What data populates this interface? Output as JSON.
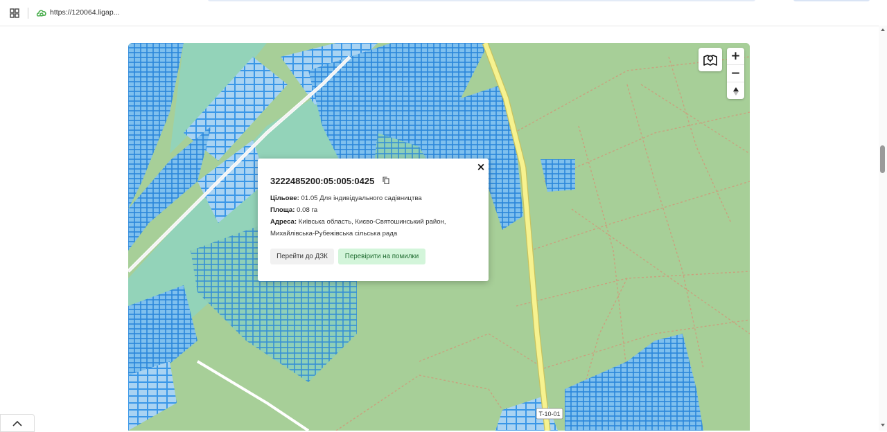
{
  "browser": {
    "url": "https://120064.ligap..."
  },
  "map": {
    "road_label": "T-10-01",
    "zoom_in": "+",
    "zoom_out": "−",
    "reset_north": "▲",
    "layers_icon": "map-layers-icon",
    "colors": {
      "forest": "#a7cf98",
      "parcel_fill": "#a9d3f2",
      "parcel_stroke": "#1e88e5",
      "parcel_selected": "#3d9be9",
      "industrial": "#93d3b9",
      "main_road": "#f6f28f",
      "path": "#c9a17e"
    }
  },
  "popup": {
    "cadastral_number": "3222485200:05:005:0425",
    "purpose_label": "Цільове:",
    "purpose_value": "01.05 Для індивідуального садівництва",
    "area_label": "Площа:",
    "area_value": "0.08 га",
    "address_label": "Адреса:",
    "address_value_line1": "Київська область, Києво-Святошинський район,",
    "address_value_line2": "Михайлівська-Рубежівська сільська рада",
    "goto_dzk_label": "Перейти до ДЗК",
    "check_errors_label": "Перевірити на помилки",
    "close_label": "×"
  }
}
